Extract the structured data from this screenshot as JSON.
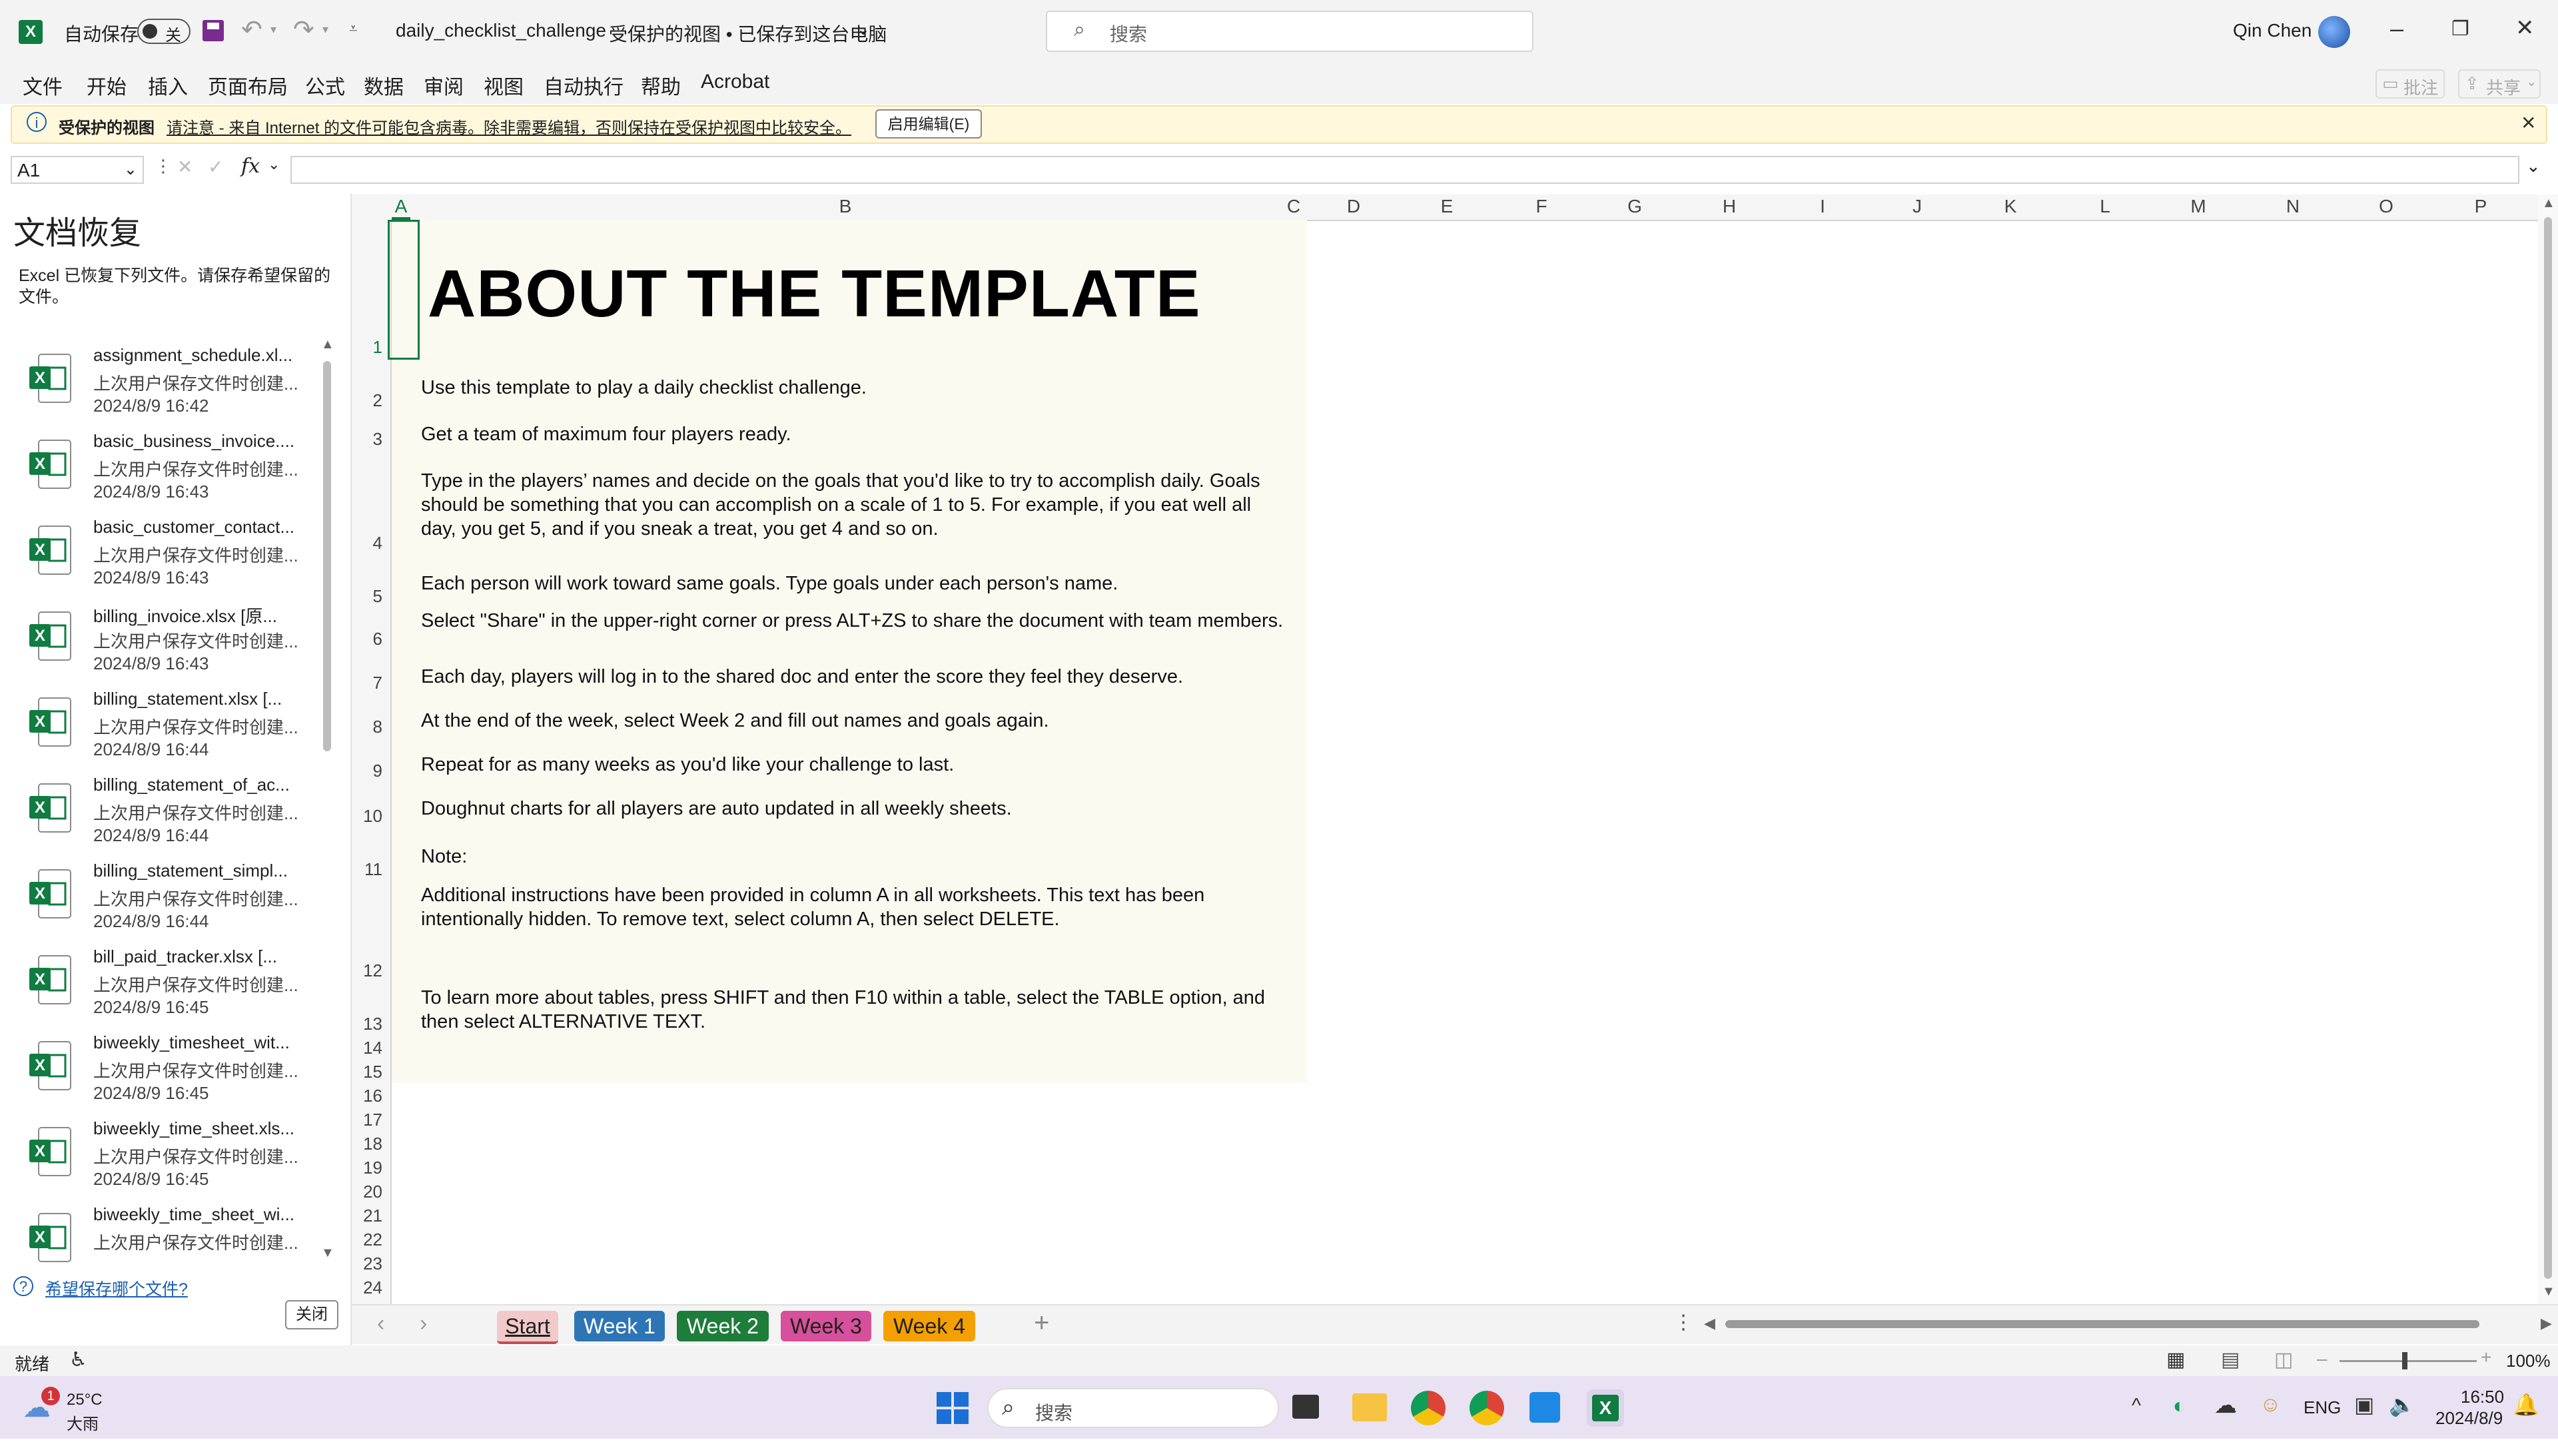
{
  "title_bar": {
    "autosave_label": "自动保存",
    "autosave_state": "关",
    "doc_name": "daily_checklist_challenge",
    "doc_status": "受保护的视图 • 已保存到这台电脑",
    "search_placeholder": "搜索",
    "user_name": "Qin Chen"
  },
  "menu": [
    "文件",
    "开始",
    "插入",
    "页面布局",
    "公式",
    "数据",
    "审阅",
    "视图",
    "自动执行",
    "帮助",
    "Acrobat"
  ],
  "ribbon_right": {
    "comment_label": "批注",
    "share_label": "共享"
  },
  "protected_bar": {
    "label": "受保护的视图",
    "message": "请注意 - 来自 Internet 的文件可能包含病毒。除非需要编辑，否则保持在受保护视图中比较安全。",
    "enable_button": "启用编辑(E)"
  },
  "formula_bar": {
    "name_box": "A1",
    "fx": "fx"
  },
  "recovery": {
    "title": "文档恢复",
    "description": "Excel 已恢复下列文件。请保存希望保留的文件。",
    "items": [
      {
        "name": "assignment_schedule.xl...",
        "desc": "上次用户保存文件时创建...",
        "date": "2024/8/9 16:42"
      },
      {
        "name": "basic_business_invoice....",
        "desc": "上次用户保存文件时创建...",
        "date": "2024/8/9 16:43"
      },
      {
        "name": "basic_customer_contact...",
        "desc": "上次用户保存文件时创建...",
        "date": "2024/8/9 16:43"
      },
      {
        "name": "billing_invoice.xlsx  [原...",
        "desc": "上次用户保存文件时创建...",
        "date": "2024/8/9 16:43"
      },
      {
        "name": "billing_statement.xlsx  [...",
        "desc": "上次用户保存文件时创建...",
        "date": "2024/8/9 16:44"
      },
      {
        "name": "billing_statement_of_ac...",
        "desc": "上次用户保存文件时创建...",
        "date": "2024/8/9 16:44"
      },
      {
        "name": "billing_statement_simpl...",
        "desc": "上次用户保存文件时创建...",
        "date": "2024/8/9 16:44"
      },
      {
        "name": "bill_paid_tracker.xlsx  [...",
        "desc": "上次用户保存文件时创建...",
        "date": "2024/8/9 16:45"
      },
      {
        "name": "biweekly_timesheet_wit...",
        "desc": "上次用户保存文件时创建...",
        "date": "2024/8/9 16:45"
      },
      {
        "name": "biweekly_time_sheet.xls...",
        "desc": "上次用户保存文件时创建...",
        "date": "2024/8/9 16:45"
      },
      {
        "name": "biweekly_time_sheet_wi...",
        "desc": "上次用户保存文件时创建...",
        "date": ""
      }
    ],
    "which_files_link": "希望保存哪个文件?",
    "close_button": "关闭"
  },
  "columns": [
    "A",
    "B",
    "C",
    "D",
    "E",
    "F",
    "G",
    "H",
    "I",
    "J",
    "K",
    "L",
    "M",
    "N",
    "O",
    "P"
  ],
  "rows": [
    "1",
    "2",
    "3",
    "4",
    "5",
    "6",
    "7",
    "8",
    "9",
    "10",
    "11",
    "12",
    "13",
    "14",
    "15",
    "16",
    "17",
    "18",
    "19",
    "20",
    "21",
    "22",
    "23",
    "24"
  ],
  "sheet": {
    "heading": "ABOUT THE TEMPLATE",
    "lines": [
      "Use this template to play a daily checklist challenge.",
      "Get a team of maximum four players ready.",
      "Type in the players’ names and decide on the goals that you'd like to try to accomplish daily. Goals should be something that you can accomplish on a scale of 1 to 5. For example, if you eat well all day, you get 5, and if you sneak a treat, you get 4 and so on.",
      "Each person will work toward same goals. Type goals under each person's name.",
      "Select \"Share\" in the upper-right corner or press ALT+ZS to share the document with team members.",
      "Each day, players will log in to the shared doc and enter the score they feel they deserve.",
      "At the end of the week, select Week 2 and fill out names and goals again.",
      "Repeat for as many weeks as you'd like your challenge to last.",
      "Doughnut charts for all players are auto updated in all weekly sheets.",
      "Note:",
      "Additional instructions have been provided in column A in all worksheets. This text has been intentionally hidden. To remove text, select column A, then select DELETE.",
      "To learn more about tables, press SHIFT and then F10 within a table, select the TABLE option, and then select ALTERNATIVE TEXT."
    ]
  },
  "tabs": [
    {
      "label": "Start",
      "color": "#f2c9c9",
      "text": "#1f1f1f"
    },
    {
      "label": "Week 1",
      "color": "#2e75b6",
      "text": "#ffffff"
    },
    {
      "label": "Week 2",
      "color": "#1e7d3a",
      "text": "#ffffff"
    },
    {
      "label": "Week 3",
      "color": "#d7509b",
      "text": "#1f1f1f"
    },
    {
      "label": "Week 4",
      "color": "#f4a000",
      "text": "#1f1f1f"
    }
  ],
  "status": {
    "ready": "就绪",
    "zoom": "100%"
  },
  "taskbar": {
    "weather_temp": "25°C",
    "weather_desc": "大雨",
    "weather_badge": "1",
    "search_placeholder": "搜索",
    "lang": "ENG",
    "time": "16:50",
    "date": "2024/8/9"
  },
  "colors": {
    "excel_green": "#107c41",
    "accent_blue": "#2e75b6"
  }
}
